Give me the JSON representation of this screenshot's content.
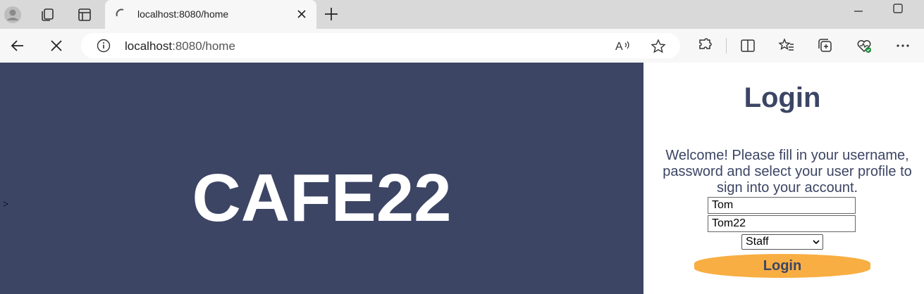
{
  "browser": {
    "tab_title": "localhost:8080/home",
    "url_host": "localhost",
    "url_rest": ":8080/home"
  },
  "page": {
    "brand": "CAFE22",
    "stray_text": ">",
    "login_title": "Login",
    "welcome_text": "Welcome! Please fill in your username, password and select your user profile to sign into your account.",
    "username_value": "Tom",
    "password_value": "Tom22",
    "profile_selected": "Staff",
    "login_button": "Login"
  },
  "colors": {
    "panel": "#3c4564",
    "button": "#f8ae42"
  }
}
